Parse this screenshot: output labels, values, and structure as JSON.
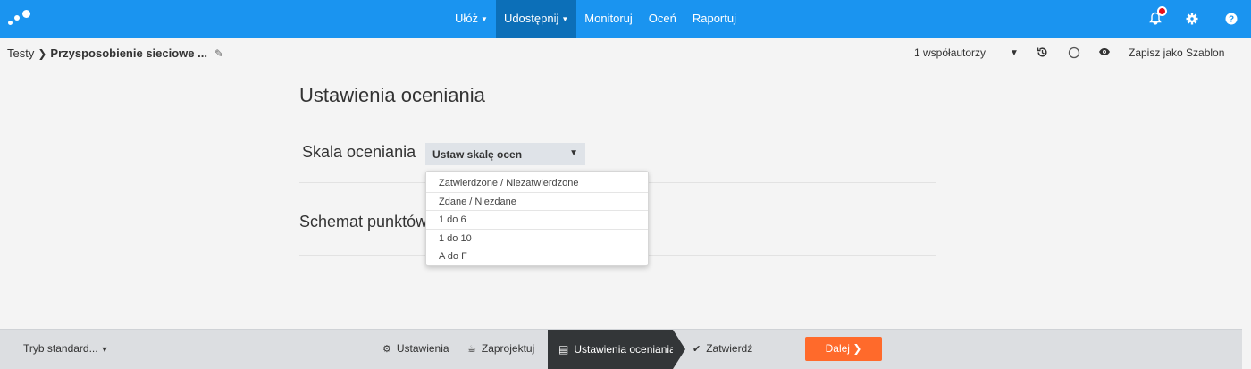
{
  "colors": {
    "topbar": "#1a94f0",
    "topbar_active": "#0c6fb8",
    "next_button": "#ff6a2b",
    "active_step": "#333638",
    "notification_dot": "#e8101a"
  },
  "nav": {
    "items": [
      {
        "label": "Ułóż",
        "has_caret": true
      },
      {
        "label": "Udostępnij",
        "has_caret": true,
        "active": true
      },
      {
        "label": "Monitoruj"
      },
      {
        "label": "Oceń"
      },
      {
        "label": "Raportuj"
      }
    ],
    "icons": [
      "bell-icon",
      "gear-icon",
      "help-icon"
    ]
  },
  "breadcrumb": {
    "root": "Testy",
    "current": "Przysposobienie sieciowe ..."
  },
  "subheader": {
    "coauthors": "1 współautorzy",
    "save_template": "Zapisz jako Szablon"
  },
  "main": {
    "title": "Ustawienia oceniania",
    "scale_label": "Skala oceniania",
    "scale_select_value": "Ustaw skalę ocen",
    "points_scheme_label": "Schemat punktów",
    "dropdown_options": [
      "Zatwierdzone / Niezatwierdzone",
      "Zdane / Niezdane",
      "1 do 6",
      "1 do 10",
      "A do F"
    ]
  },
  "footer": {
    "mode": "Tryb standard...",
    "steps": [
      "Ustawienia",
      "Zaprojektuj",
      "Ustawienia oceniania",
      "Zatwierdź"
    ],
    "active_step": "Ustawienia oceniania",
    "next": "Dalej"
  }
}
